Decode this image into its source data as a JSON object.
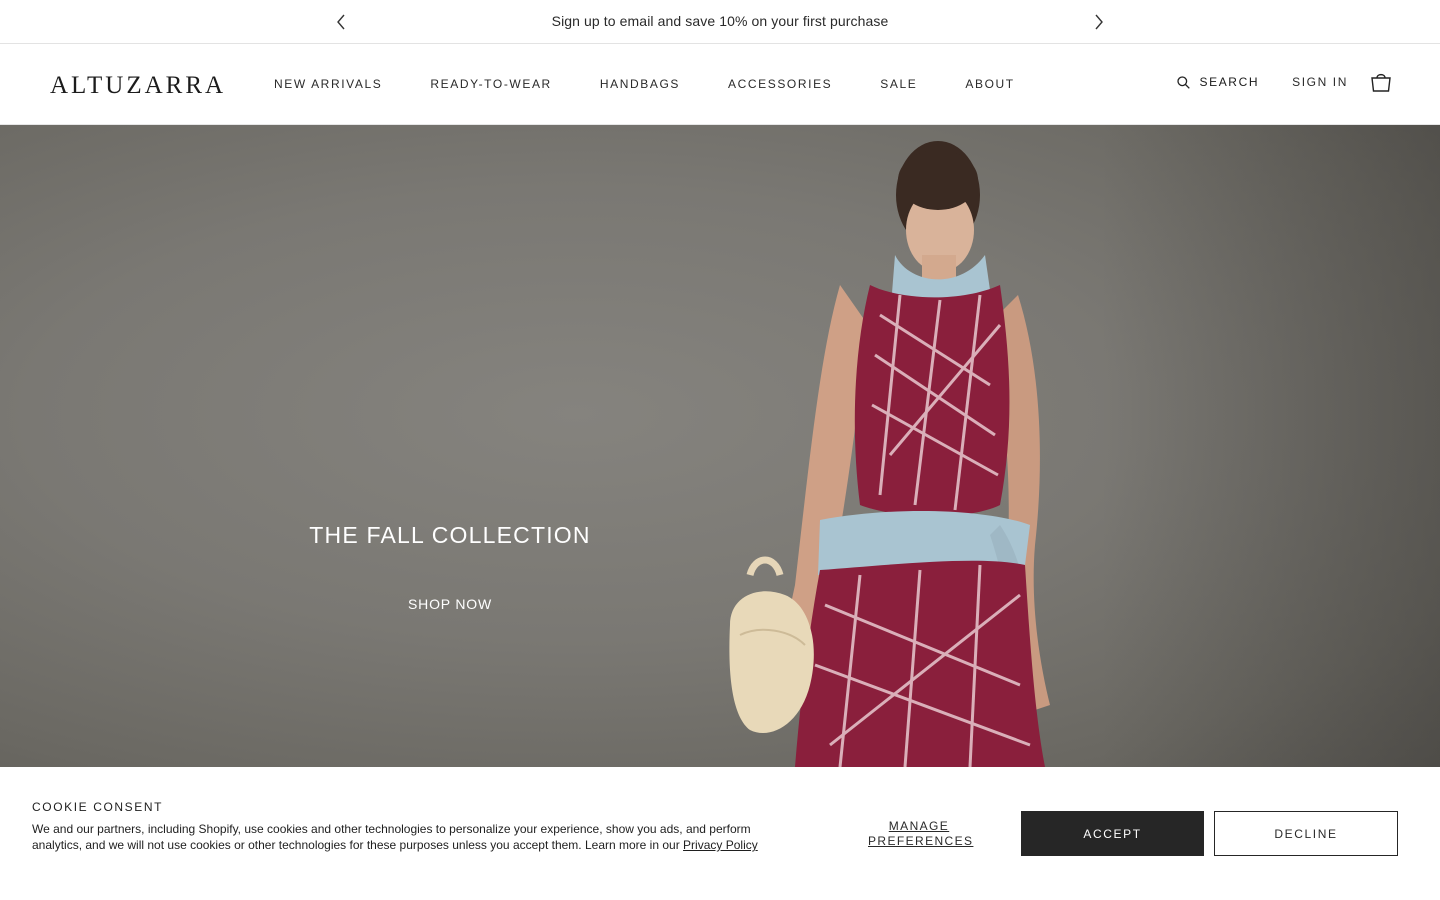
{
  "announcement": {
    "message": "Sign up to email and save 10% on your first purchase",
    "prev_icon": "chevron-left-icon",
    "next_icon": "chevron-right-icon"
  },
  "header": {
    "logo": "ALTUZARRA",
    "nav": [
      {
        "label": "NEW ARRIVALS"
      },
      {
        "label": "READY-TO-WEAR"
      },
      {
        "label": "HANDBAGS"
      },
      {
        "label": "ACCESSORIES"
      },
      {
        "label": "SALE"
      },
      {
        "label": "ABOUT"
      }
    ],
    "search_label": "SEARCH",
    "signin_label": "SIGN IN",
    "cart_icon": "shopping-bag-icon"
  },
  "hero": {
    "title": "THE FALL COLLECTION",
    "cta": "SHOP NOW"
  },
  "cookie": {
    "title": "COOKIE CONSENT",
    "body": "We and our partners, including Shopify, use cookies and other technologies to personalize your experience, show you ads, and perform analytics, and we will not use cookies or other technologies for these purposes unless you accept them. Learn more in our",
    "policy_link": "Privacy Policy",
    "manage": "MANAGE PREFERENCES",
    "accept": "ACCEPT",
    "decline": "DECLINE"
  },
  "colors": {
    "accent_dark": "#262626",
    "hero_background": "#7a7873",
    "dress": "#8a1f3c",
    "scarf": "#a9c4d1"
  }
}
